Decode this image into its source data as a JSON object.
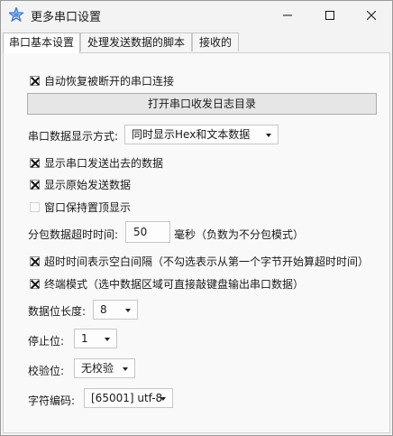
{
  "window": {
    "title": "更多串口设置",
    "icon": "star-app-icon"
  },
  "tabs": [
    {
      "label": "串口基本设置",
      "active": true
    },
    {
      "label": "处理发送数据的脚本",
      "active": false
    },
    {
      "label": "接收的",
      "active": false
    }
  ],
  "settings": {
    "auto_reconnect": {
      "label": "自动恢复被断开的串口连接",
      "checked": true
    },
    "open_log_dir_button": "打开串口收发日志目录",
    "display_mode": {
      "label": "串口数据显示方式:",
      "value": "同时显示Hex和文本数据"
    },
    "show_sent": {
      "label": "显示串口发送出去的数据",
      "checked": true
    },
    "show_raw": {
      "label": "显示原始发送数据",
      "checked": true
    },
    "always_on_top": {
      "label": "窗口保持置顶显示",
      "checked": false
    },
    "packet_timeout": {
      "label": "分包数据超时时间:",
      "value": "50",
      "unit": "毫秒（负数为不分包模式）"
    },
    "timeout_gap": {
      "label": "超时时间表示空白间隔（不勾选表示从第一个字节开始算超时时间）",
      "checked": true
    },
    "terminal_mode": {
      "label": "终端模式（选中数据区域可直接敲键盘输出串口数据）",
      "checked": true
    },
    "data_bits": {
      "label": "数据位长度:",
      "value": "8"
    },
    "stop_bits": {
      "label": "停止位:",
      "value": "1"
    },
    "parity": {
      "label": "校验位:",
      "value": "无校验"
    },
    "encoding": {
      "label": "字符编码:",
      "value": "[65001] utf-8"
    }
  }
}
